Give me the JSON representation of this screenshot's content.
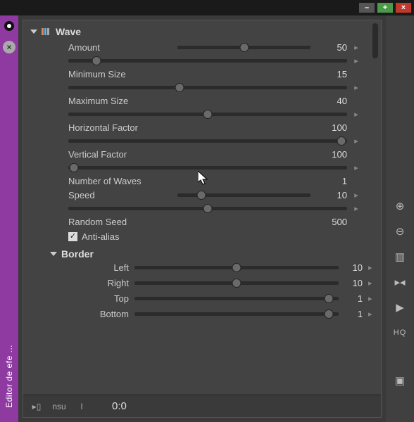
{
  "titlebar": {
    "min": "–",
    "max": "+",
    "close": "×"
  },
  "sidebar": {
    "title": "Editor de efe ...",
    "close": "×"
  },
  "sections": {
    "wave": {
      "title": "Wave",
      "params": [
        {
          "label": "Amount",
          "value": "50",
          "pos": 50,
          "key": "▸"
        },
        {
          "label": "",
          "value": "",
          "pos": 10,
          "key": "▸"
        },
        {
          "label": "Minimum Size",
          "value": "15",
          "pos": null,
          "key": ""
        },
        {
          "label": "",
          "value": "",
          "pos": 40,
          "key": "▸"
        },
        {
          "label": "Maximum Size",
          "value": "40",
          "pos": null,
          "key": ""
        },
        {
          "label": "",
          "value": "",
          "pos": 50,
          "key": "▸"
        },
        {
          "label": "Horizontal Factor",
          "value": "100",
          "pos": null,
          "key": ""
        },
        {
          "label": "",
          "value": "",
          "pos": 98,
          "key": "▸"
        },
        {
          "label": "Vertical Factor",
          "value": "100",
          "pos": null,
          "key": ""
        },
        {
          "label": "",
          "value": "",
          "pos": 2,
          "key": "▸"
        },
        {
          "label": "Number of Waves",
          "value": "1",
          "pos": null,
          "key": ""
        },
        {
          "label": "Speed",
          "value": "10",
          "pos": 18,
          "key": "▸",
          "inline": true
        },
        {
          "label": "",
          "value": "",
          "pos": 50,
          "key": "▸"
        },
        {
          "label": "Random Seed",
          "value": "500",
          "pos": null,
          "key": ""
        }
      ],
      "antialias": {
        "label": "Anti-alias",
        "checked": true
      }
    },
    "border": {
      "title": "Border",
      "params": [
        {
          "label": "Left",
          "value": "10",
          "pos": 50,
          "key": "▸"
        },
        {
          "label": "Right",
          "value": "10",
          "pos": 50,
          "key": "▸"
        },
        {
          "label": "Top",
          "value": "1",
          "pos": 95,
          "key": "▸"
        },
        {
          "label": "Bottom",
          "value": "1",
          "pos": 95,
          "key": "▸"
        }
      ]
    }
  },
  "statusbar": {
    "timecode": "0:0",
    "label_nsu": "nsu"
  },
  "rightbar": {
    "hq": "HQ"
  }
}
